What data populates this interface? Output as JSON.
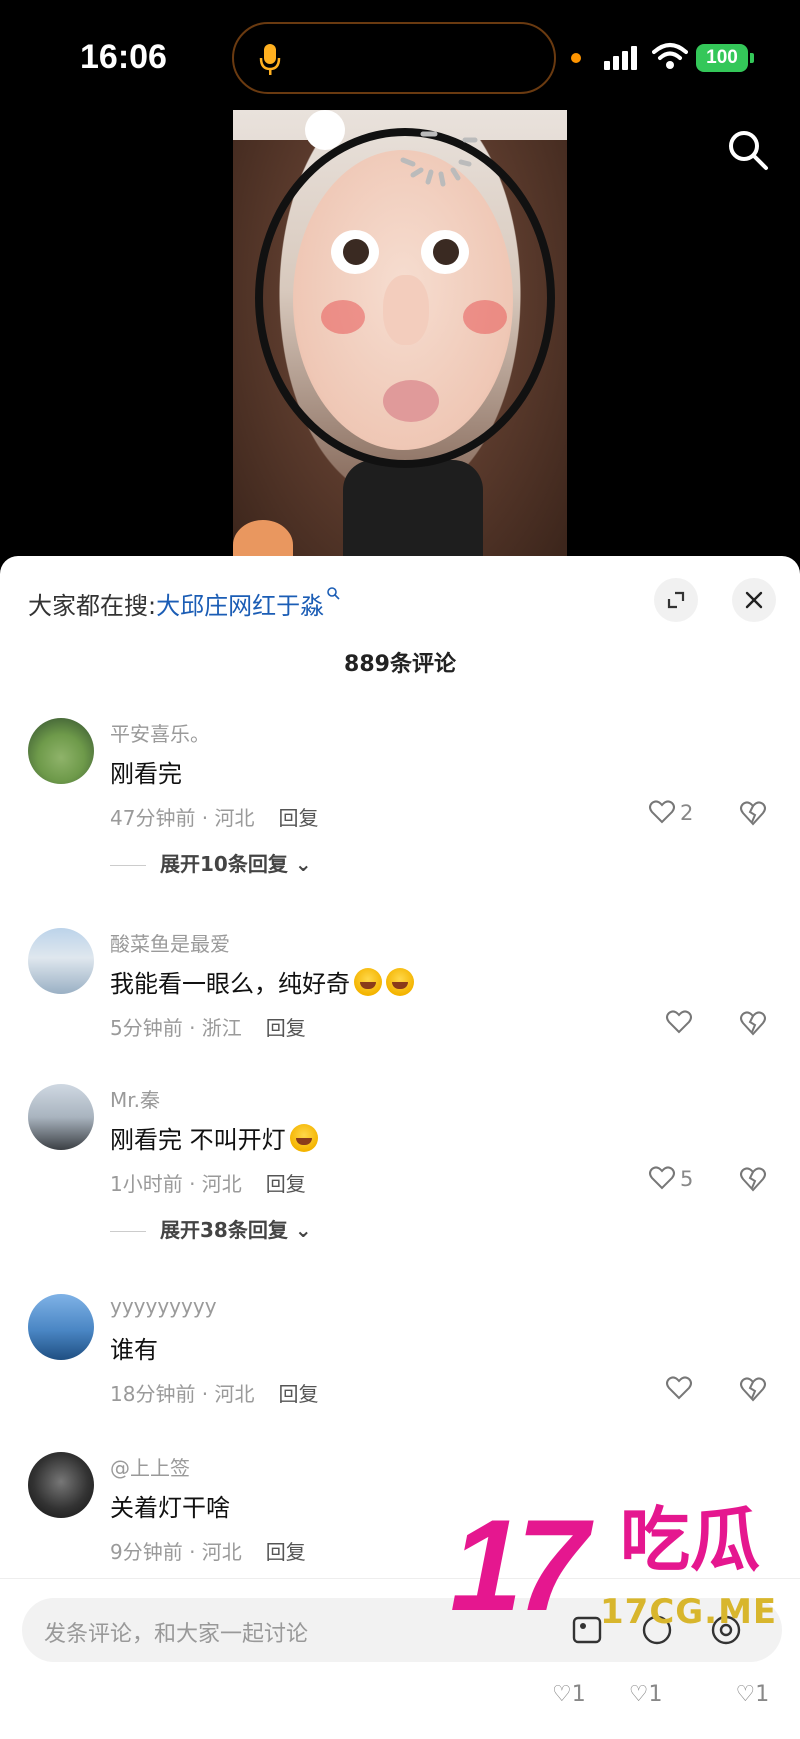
{
  "status_bar": {
    "time": "16:06",
    "battery": "100"
  },
  "comments_panel": {
    "trending_prefix": "大家都在搜:",
    "trending_term": "大邱庄网红于淼",
    "comment_count": "889条评论",
    "input_placeholder": "发条评论，和大家一起讨论"
  },
  "comments": [
    {
      "username": "平安喜乐。",
      "text": "刚看完",
      "time_location": "47分钟前 · 河北",
      "reply_label": "回复",
      "likes": "2",
      "expand_label": "展开10条回复"
    },
    {
      "username": "酸菜鱼是最爱",
      "text": "我能看一眼么，纯好奇",
      "emojis": [
        "laughing-crying",
        "laughing-crying"
      ],
      "time_location": "5分钟前 · 浙江",
      "reply_label": "回复",
      "likes": ""
    },
    {
      "username": "Mr.秦",
      "text": "刚看完 不叫开灯",
      "emojis": [
        "laughing-crying"
      ],
      "time_location": "1小时前 · 河北",
      "reply_label": "回复",
      "likes": "5",
      "expand_label": "展开38条回复"
    },
    {
      "username": "yyyyyyyyy",
      "text": "谁有",
      "time_location": "18分钟前 · 河北",
      "reply_label": "回复",
      "likes": ""
    },
    {
      "username": "@上上签",
      "text": "关着灯干啥",
      "time_location": "9分钟前 · 河北",
      "reply_label": "回复",
      "likes": ""
    }
  ],
  "bottom_likes": [
    "1",
    "1",
    "1"
  ],
  "watermark": {
    "number": "17",
    "cn": "吃瓜",
    "url": "17CG.ME"
  },
  "colors": {
    "accent_link": "#1b5db5",
    "watermark_pink": "#e5178f",
    "watermark_gold": "#d8b62d",
    "battery_green": "#34c759"
  }
}
